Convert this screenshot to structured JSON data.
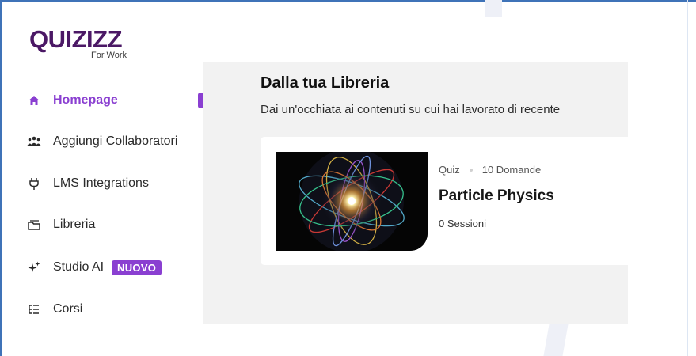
{
  "brand": {
    "name": "QUIZIZZ",
    "subtitle": "For Work"
  },
  "sidebar": {
    "items": [
      {
        "label": "Homepage",
        "icon": "home-icon",
        "active": true
      },
      {
        "label": "Aggiungi Collaboratori",
        "icon": "users-icon"
      },
      {
        "label": "LMS Integrations",
        "icon": "plug-icon"
      },
      {
        "label": "Libreria",
        "icon": "folder-icon"
      },
      {
        "label": "Studio AI",
        "icon": "sparkles-icon",
        "badge": "NUOVO"
      },
      {
        "label": "Corsi",
        "icon": "list-icon"
      }
    ]
  },
  "library": {
    "title": "Dalla tua Libreria",
    "subtitle": "Dai un'occhiata ai contenuti su cui hai lavorato di recente",
    "card": {
      "type": "Quiz",
      "questions": "10 Domande",
      "title": "Particle Physics",
      "sessions": "0 Sessioni"
    }
  },
  "colors": {
    "accent": "#8a3fd1",
    "brand": "#4b1865",
    "panel": "#f2f2f2"
  }
}
